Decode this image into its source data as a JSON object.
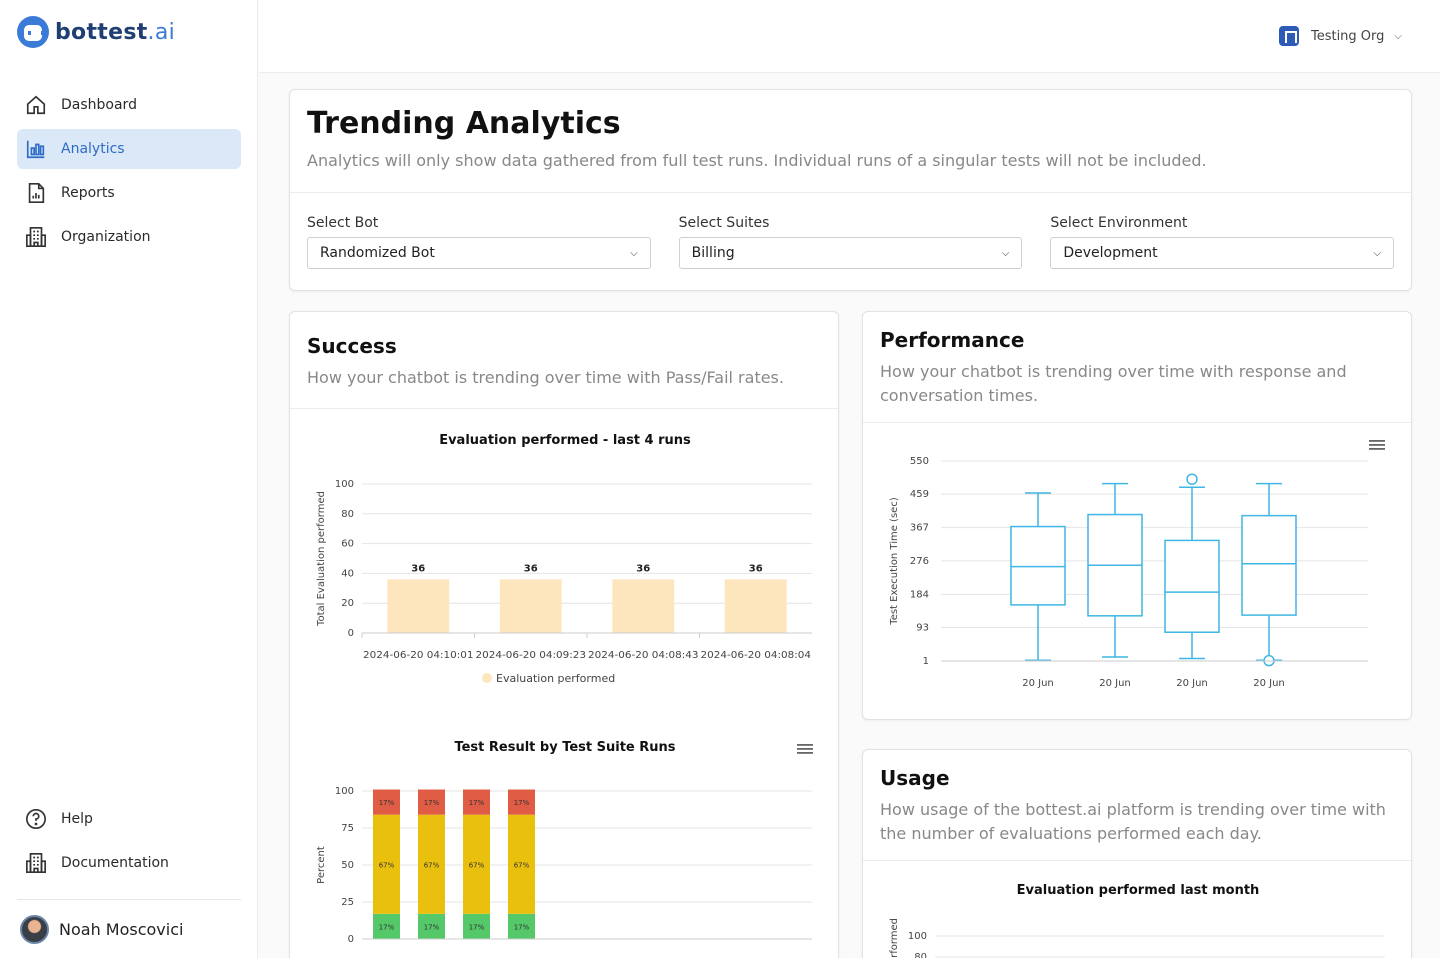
{
  "brand": {
    "name_main": "bottest",
    "name_suffix": ".ai"
  },
  "nav": {
    "items": [
      {
        "label": "Dashboard",
        "icon": "home-icon"
      },
      {
        "label": "Analytics",
        "icon": "bar-chart-icon",
        "active": true
      },
      {
        "label": "Reports",
        "icon": "report-icon"
      },
      {
        "label": "Organization",
        "icon": "building-icon"
      }
    ],
    "bottom": [
      {
        "label": "Help",
        "icon": "help-icon"
      },
      {
        "label": "Documentation",
        "icon": "documentation-icon"
      }
    ]
  },
  "user": {
    "name": "Noah Moscovici"
  },
  "topbar": {
    "org_name": "Testing Org"
  },
  "trending": {
    "title": "Trending Analytics",
    "subtitle": "Analytics will only show data gathered from full test runs. Individual runs of a singular tests will not be included.",
    "filters": [
      {
        "label": "Select Bot",
        "value": "Randomized Bot"
      },
      {
        "label": "Select Suites",
        "value": "Billing"
      },
      {
        "label": "Select Environment",
        "value": "Development"
      }
    ]
  },
  "success": {
    "title": "Success",
    "subtitle": "How your chatbot is trending over time with Pass/Fail rates."
  },
  "performance": {
    "title": "Performance",
    "subtitle": "How your chatbot is trending over time with response and conversation times."
  },
  "usage": {
    "title": "Usage",
    "subtitle": "How usage of the bottest.ai platform is trending over time with the number of evaluations performed each day."
  },
  "colors": {
    "accent": "#2e6bc6",
    "bar_fill": "#fde6bd",
    "box_stroke": "#3fb6e3",
    "fail": "#e05c44",
    "warn": "#e9c00d",
    "pass": "#55c86a"
  },
  "chart_data": [
    {
      "type": "bar",
      "title": "Evaluation performed - last 4 runs",
      "ylabel": "Total Evaluation performed",
      "categories": [
        "2024-06-20 04:10:01",
        "2024-06-20 04:09:23",
        "2024-06-20 04:08:43",
        "2024-06-20 04:08:04"
      ],
      "values": [
        36,
        36,
        36,
        36
      ],
      "series_name": "Evaluation performed",
      "yticks": [
        0,
        20,
        40,
        60,
        80,
        100
      ],
      "ylim": [
        0,
        100
      ]
    },
    {
      "type": "bar",
      "stacked": true,
      "title": "Test Result by Test Suite Runs",
      "ylabel": "Percent",
      "yticks": [
        0,
        25,
        50,
        75,
        100
      ],
      "ylim": [
        0,
        100
      ],
      "series": [
        {
          "values": [
            17,
            17,
            17,
            17
          ],
          "labels": [
            "17%",
            "17%",
            "17%",
            "17%"
          ],
          "color": "#55c86a"
        },
        {
          "values": [
            67,
            67,
            67,
            67
          ],
          "labels": [
            "67%",
            "67%",
            "67%",
            "67%"
          ],
          "color": "#e9c00d"
        },
        {
          "values": [
            17,
            17,
            17,
            17
          ],
          "labels": [
            "17%",
            "17%",
            "17%",
            "17%"
          ],
          "color": "#e05c44"
        }
      ]
    },
    {
      "type": "box",
      "ylabel": "Test Execution Time (sec)",
      "categories": [
        "20 Jun",
        "20 Jun",
        "20 Jun",
        "20 Jun"
      ],
      "yticks": [
        1,
        93,
        184,
        276,
        367,
        459,
        550
      ],
      "ylim": [
        1,
        550
      ],
      "boxes": [
        {
          "min": 3,
          "q1": 155,
          "median": 260,
          "q3": 370,
          "max": 462
        },
        {
          "min": 12,
          "q1": 125,
          "median": 264,
          "q3": 403,
          "max": 488
        },
        {
          "min": 8,
          "q1": 80,
          "median": 190,
          "q3": 332,
          "max": 478,
          "outliers": [
            500
          ]
        },
        {
          "min": 3,
          "q1": 127,
          "median": 268,
          "q3": 400,
          "max": 488,
          "outliers": [
            2
          ]
        }
      ]
    },
    {
      "type": "bar",
      "title": "Evaluation performed last month",
      "ylabel": "erformed",
      "yticks": [
        80,
        100
      ]
    }
  ]
}
